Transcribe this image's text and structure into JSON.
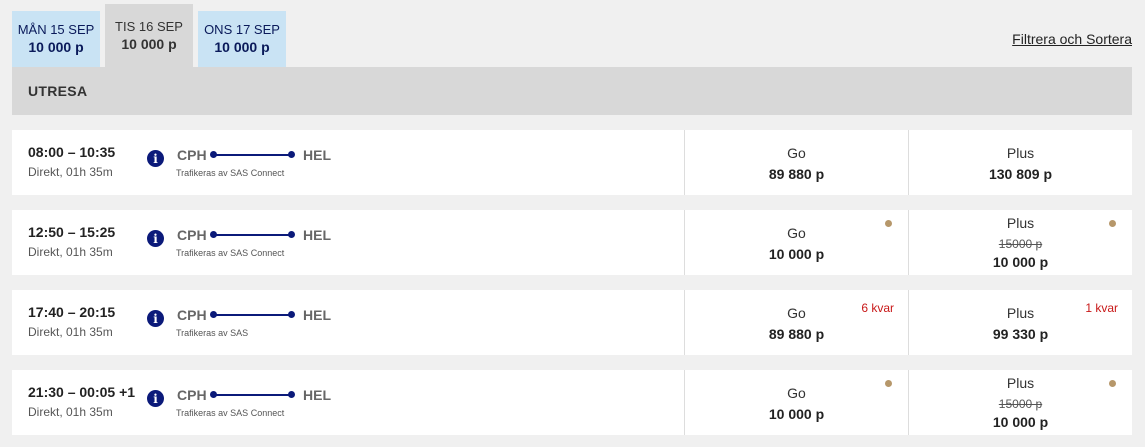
{
  "date_tabs": [
    {
      "day": "MÅN 15 SEP",
      "price": "10 000 p",
      "active": false
    },
    {
      "day": "TIS 16 SEP",
      "price": "10 000 p",
      "active": true
    },
    {
      "day": "ONS 17 SEP",
      "price": "10 000 p",
      "active": false
    }
  ],
  "filter_link": "Filtrera och Sortera",
  "section": {
    "title": "UTRESA"
  },
  "flights": [
    {
      "times": "08:00 – 10:35",
      "duration": "Direkt, 01h 35m",
      "origin": "CPH",
      "destination": "HEL",
      "operator": "Trafikeras av SAS Connect",
      "go": {
        "name": "Go",
        "price": "89 880 p",
        "old_price": "",
        "seats_left": "",
        "marker": false
      },
      "plus": {
        "name": "Plus",
        "price": "130 809 p",
        "old_price": "",
        "seats_left": "",
        "marker": false
      }
    },
    {
      "times": "12:50 – 15:25",
      "duration": "Direkt, 01h 35m",
      "origin": "CPH",
      "destination": "HEL",
      "operator": "Trafikeras av SAS Connect",
      "go": {
        "name": "Go",
        "price": "10 000 p",
        "old_price": "",
        "seats_left": "",
        "marker": true
      },
      "plus": {
        "name": "Plus",
        "price": "10 000 p",
        "old_price": "15000 p",
        "seats_left": "",
        "marker": true
      }
    },
    {
      "times": "17:40 – 20:15",
      "duration": "Direkt, 01h 35m",
      "origin": "CPH",
      "destination": "HEL",
      "operator": "Trafikeras av SAS",
      "go": {
        "name": "Go",
        "price": "89 880 p",
        "old_price": "",
        "seats_left": "6 kvar",
        "marker": false
      },
      "plus": {
        "name": "Plus",
        "price": "99 330 p",
        "old_price": "",
        "seats_left": "1 kvar",
        "marker": false
      }
    },
    {
      "times": "21:30 – 00:05 +1",
      "duration": "Direkt, 01h 35m",
      "origin": "CPH",
      "destination": "HEL",
      "operator": "Trafikeras av SAS Connect",
      "go": {
        "name": "Go",
        "price": "10 000 p",
        "old_price": "",
        "seats_left": "",
        "marker": true
      },
      "plus": {
        "name": "Plus",
        "price": "10 000 p",
        "old_price": "15000 p",
        "seats_left": "",
        "marker": true
      }
    }
  ],
  "colors": {
    "accent": "#0b1a7a",
    "tab_inactive": "#c9e3f4",
    "marker": "#b6976a",
    "alert": "#c81818"
  },
  "icons": {
    "info": "info-icon"
  }
}
